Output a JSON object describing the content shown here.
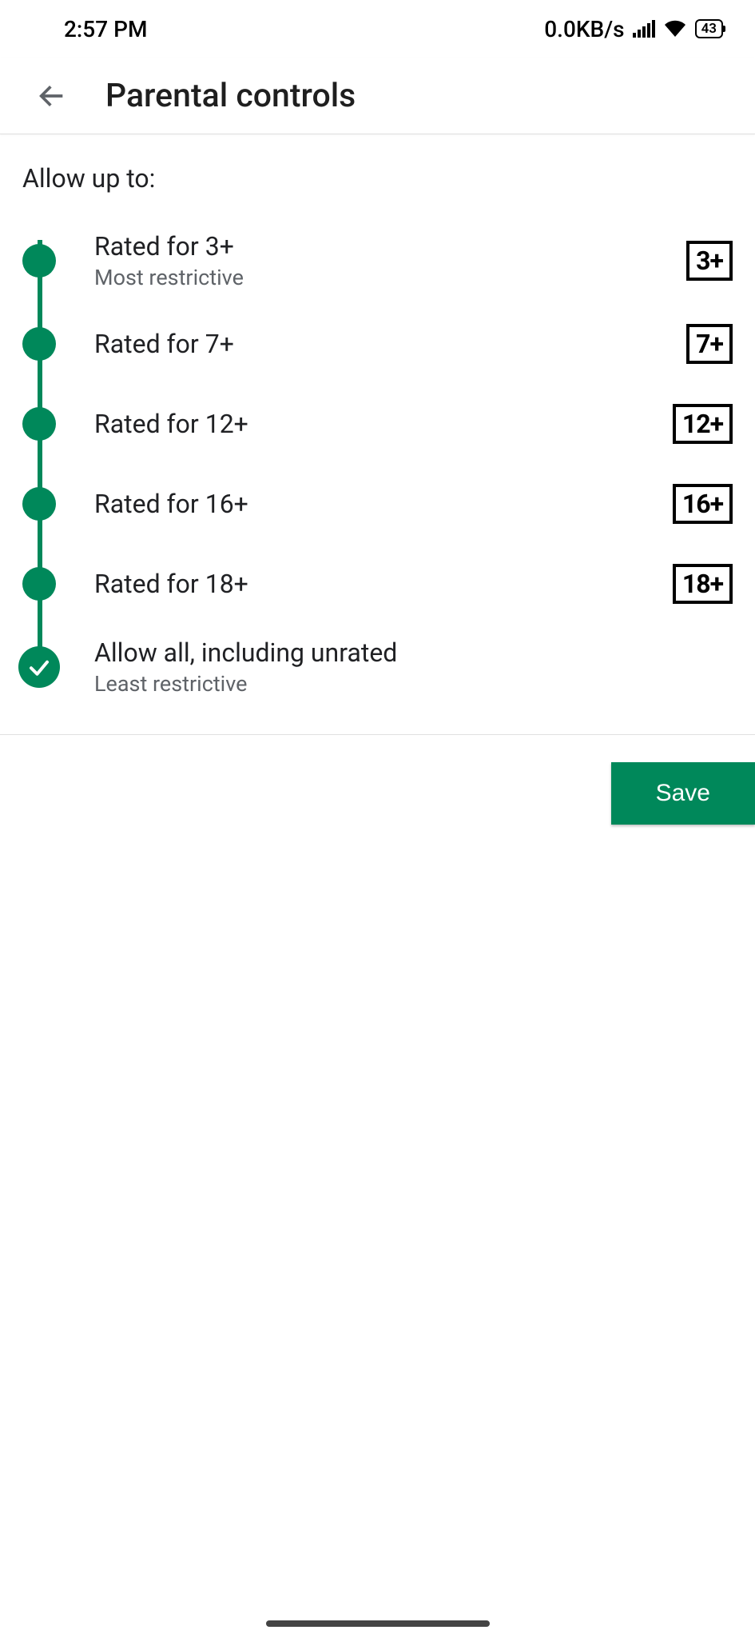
{
  "status": {
    "time": "2:57 PM",
    "network_speed": "0.0KB/s",
    "battery": "43"
  },
  "header": {
    "title": "Parental controls"
  },
  "section_label": "Allow up to:",
  "levels": [
    {
      "title": "Rated for 3+",
      "subtitle": "Most restrictive",
      "badge": "3+"
    },
    {
      "title": "Rated for 7+",
      "subtitle": "",
      "badge": "7+"
    },
    {
      "title": "Rated for 12+",
      "subtitle": "",
      "badge": "12+"
    },
    {
      "title": "Rated for 16+",
      "subtitle": "",
      "badge": "16+"
    },
    {
      "title": "Rated for 18+",
      "subtitle": "",
      "badge": "18+"
    },
    {
      "title": "Allow all, including unrated",
      "subtitle": "Least restrictive",
      "badge": ""
    }
  ],
  "selected_index": 5,
  "actions": {
    "save_label": "Save"
  },
  "colors": {
    "accent": "#00885a"
  }
}
